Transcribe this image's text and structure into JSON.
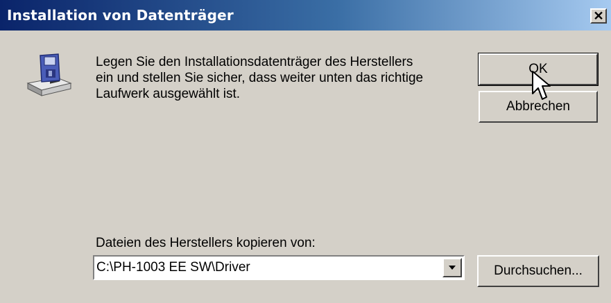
{
  "window": {
    "title": "Installation von Datenträger",
    "close_glyph": "×"
  },
  "message": {
    "line1": "Legen Sie den Installationsdatenträger des Herstellers",
    "line2": "ein und stellen Sie sicher, dass weiter unten das richtige",
    "line3": "Laufwerk ausgewählt ist."
  },
  "buttons": {
    "ok": "OK",
    "cancel": "Abbrechen",
    "browse": "Durchsuchen..."
  },
  "copy_from": {
    "label": "Dateien des Herstellers kopieren von:",
    "value": "C:\\PH-1003 EE SW\\Driver"
  },
  "icons": {
    "disk": "floppy-disk-drive-icon",
    "cursor": "mouse-pointer-icon",
    "dropdown": "dropdown-arrow-icon"
  },
  "colors": {
    "titlebar_start": "#0a246a",
    "titlebar_end": "#a6caf0",
    "dialog_bg": "#d4d0c8"
  }
}
